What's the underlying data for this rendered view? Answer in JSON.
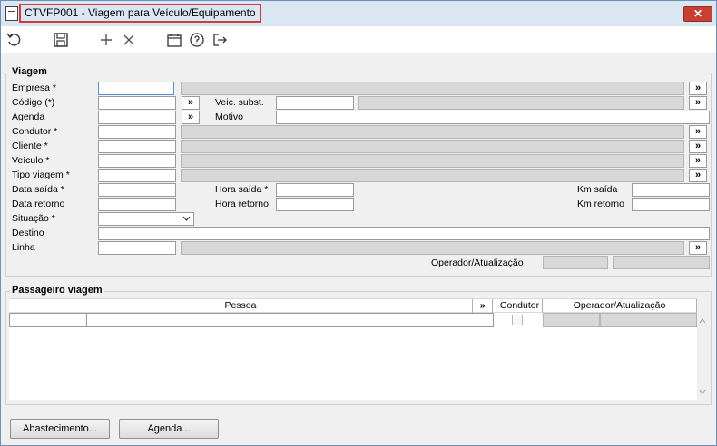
{
  "window": {
    "title": "CTVFP001 - Viagem para Veículo/Equipamento",
    "close_glyph": "✕"
  },
  "toolbar": {
    "icons": [
      "refresh-icon",
      "save-icon",
      "add-icon",
      "delete-icon",
      "calendar-icon",
      "help-icon",
      "exit-icon"
    ]
  },
  "viagem": {
    "title": "Viagem",
    "labels": {
      "empresa": "Empresa *",
      "codigo": "Código (*)",
      "agenda": "Agenda",
      "condutor": "Condutor *",
      "cliente": "Cliente *",
      "veiculo": "Veículo *",
      "tipo_viagem": "Tipo viagem *",
      "data_saida": "Data saída *",
      "data_retorno": "Data retorno",
      "situacao": "Situação *",
      "destino": "Destino",
      "linha": "Linha",
      "veic_subst": "Veic. subst.",
      "motivo": "Motivo",
      "hora_saida": "Hora saída *",
      "hora_retorno": "Hora retorno",
      "km_saida": "Km saída",
      "km_retorno": "Km retorno",
      "operador": "Operador/Atualização"
    },
    "picker_glyph": "»"
  },
  "passageiro": {
    "title": "Passageiro viagem",
    "columns": {
      "pessoa": "Pessoa",
      "condutor": "Condutor",
      "operador": "Operador/Atualização"
    },
    "picker_glyph": "»"
  },
  "buttons": {
    "abastecimento": "Abastecimento...",
    "agenda": "Agenda..."
  },
  "colors": {
    "title_highlight": "#d23b3b",
    "readonly_field": "#d8d8d8",
    "close_button": "#c84031"
  }
}
